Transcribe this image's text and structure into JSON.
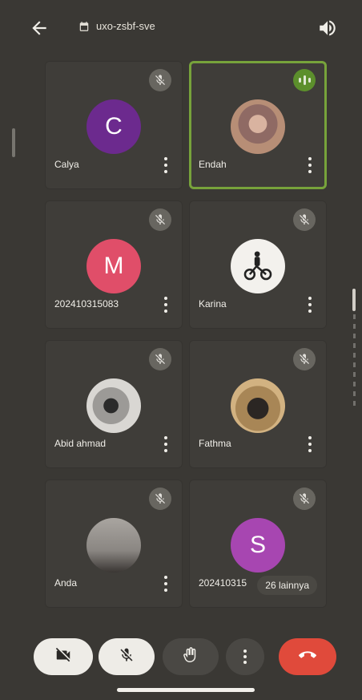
{
  "header": {
    "meeting_code": "uxo-zsbf-sve",
    "icons": {
      "back": "back-arrow-icon",
      "calendar": "calendar-icon",
      "speaker": "speaker-icon"
    }
  },
  "tiles": [
    {
      "name": "Calya",
      "initial": "C",
      "color": "#6c2a8e",
      "muted": true,
      "speaking": false
    },
    {
      "name": "Endah",
      "initial": "",
      "color": "#8f7c72",
      "muted": false,
      "speaking": true
    },
    {
      "name": "202410315083",
      "initial": "M",
      "color": "#e04e69",
      "muted": true,
      "speaking": false
    },
    {
      "name": "Karina",
      "initial": "",
      "color": "#f3f1ed",
      "muted": true,
      "speaking": false
    },
    {
      "name": "Abid ahmad",
      "initial": "",
      "color": "#7b7a76",
      "muted": true,
      "speaking": false
    },
    {
      "name": "Fathma",
      "initial": "",
      "color": "#8a6e40",
      "muted": true,
      "speaking": false
    },
    {
      "name": "Anda",
      "initial": "",
      "color": "#7a7672",
      "muted": true,
      "speaking": false
    },
    {
      "name": "202410315",
      "initial": "S",
      "color": "#a746b1",
      "muted": true,
      "speaking": false
    }
  ],
  "more_participants": "26 lainnya",
  "controls": {
    "camera": "camera-off-icon",
    "mic": "mic-off-icon",
    "hand": "raise-hand-icon",
    "more": "more-options-icon",
    "end": "end-call-icon"
  }
}
